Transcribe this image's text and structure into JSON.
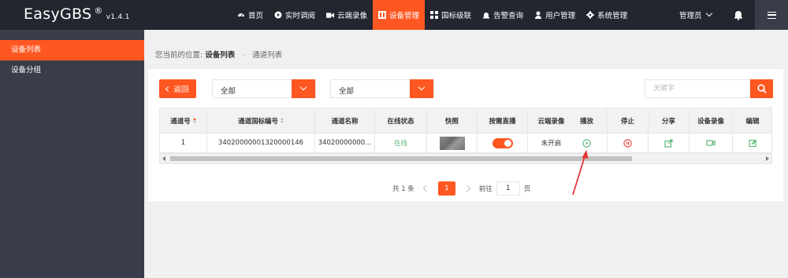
{
  "app": {
    "name": "EasyGBS",
    "reg": "®",
    "version": "v1.4.1"
  },
  "nav": [
    {
      "label": "首页",
      "icon": "dashboard-icon"
    },
    {
      "label": "实时调阅",
      "icon": "play-circle-icon"
    },
    {
      "label": "云端录像",
      "icon": "video-camera-icon"
    },
    {
      "label": "设备管理",
      "icon": "device-grid-icon",
      "active": true
    },
    {
      "label": "国标级联",
      "icon": "cascade-icon"
    },
    {
      "label": "告警查询",
      "icon": "alarm-icon"
    },
    {
      "label": "用户管理",
      "icon": "user-icon"
    },
    {
      "label": "系统管理",
      "icon": "gear-icon"
    }
  ],
  "user": {
    "label": "管理员"
  },
  "sidebar": {
    "items": [
      {
        "label": "设备列表",
        "active": true
      },
      {
        "label": "设备分组"
      }
    ]
  },
  "breadcrumb": {
    "prefix": "您当前的位置:",
    "current": "设备列表",
    "sub": "通道列表"
  },
  "toolbar": {
    "back_label": "返回",
    "select1_value": "全部",
    "select2_value": "全部",
    "search_placeholder": "关键字"
  },
  "table": {
    "headers": [
      "通道号",
      "通道国标编号",
      "通道名称",
      "在线状态",
      "快照",
      "按需直播",
      "云端录像",
      "播放",
      "停止",
      "分享",
      "设备录像",
      "编辑"
    ],
    "row": {
      "channel_no": "1",
      "gb_id": "34020000001320000146",
      "name": "34020000000...",
      "status": "在线",
      "record": "未开启"
    }
  },
  "pager": {
    "total": "共 1 条",
    "current": "1",
    "goto_label": "前往",
    "goto_value": "1",
    "page_unit": "页"
  },
  "colors": {
    "accent": "#ff5722",
    "topbar": "#23262e",
    "sidebar": "#393d49",
    "online": "#5fb878",
    "stop": "#e94a3c"
  }
}
